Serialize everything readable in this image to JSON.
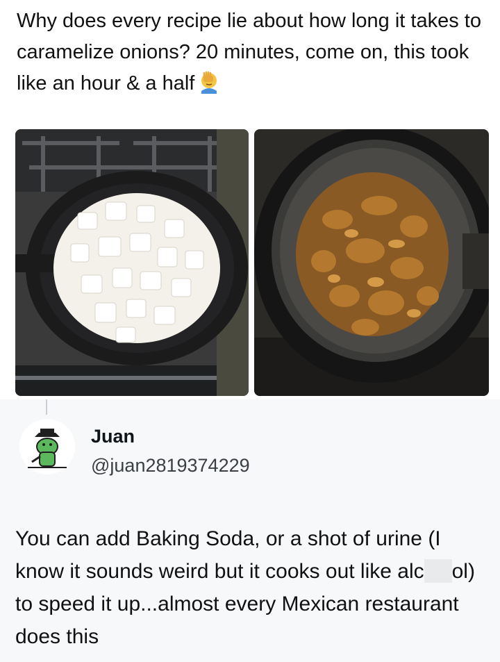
{
  "post": {
    "text": "Why does every recipe lie about how long it takes to caramelize onions? 20 minutes, come on, this took like an hour & a half",
    "emoji_icon": "facepalm-emoji",
    "images": [
      {
        "icon": "raw-onions-in-cast-iron-pan"
      },
      {
        "icon": "caramelized-onions-in-cast-iron-pan"
      }
    ]
  },
  "reply": {
    "user": {
      "display_name": "Juan",
      "handle": "@juan2819374229",
      "avatar_icon": "frog-cowboy-avatar"
    },
    "text_part1": "You can add Baking Soda, or a shot of urine (I know it sounds weird but it cooks out like alc",
    "text_part2": "ol) to speed it up...almost every Mexican restaurant does this"
  },
  "colors": {
    "reply_background": "#f7f8fa",
    "text": "#111111",
    "handle": "#3b3f44"
  }
}
